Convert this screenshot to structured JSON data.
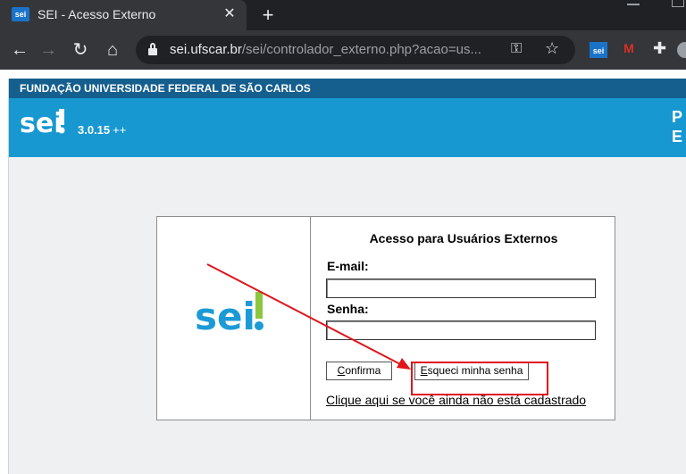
{
  "browser": {
    "tab_title": "SEI - Acesso Externo",
    "favicon_text": "sei",
    "url_host": "sei.ufscar.br",
    "url_path": "/sei/controlador_externo.php?acao=us..."
  },
  "extensions": {
    "sei_text": "sei",
    "gmail_text": "M"
  },
  "header": {
    "institution": "FUNDAÇÃO UNIVERSIDADE FEDERAL DE SÃO CARLOS",
    "logo_text": "sei",
    "version": "3.0.15",
    "version_suffix": "++",
    "right_text": "P\nE"
  },
  "login": {
    "title": "Acesso para Usuários Externos",
    "email_label": "E-mail:",
    "email_value": "",
    "password_label": "Senha:",
    "password_value": "",
    "confirm_label_u": "C",
    "confirm_label_rest": "onfirma",
    "forgot_label_u": "E",
    "forgot_label_rest": "squeci minha senha",
    "signup_link": "Clique aqui se você ainda não está cadastrado"
  },
  "colors": {
    "banner": "#1798d0",
    "institution_bar": "#155f8f",
    "annotation": "#e0141a",
    "logo_blue": "#1b9ad6",
    "logo_green": "#8cc63f"
  }
}
